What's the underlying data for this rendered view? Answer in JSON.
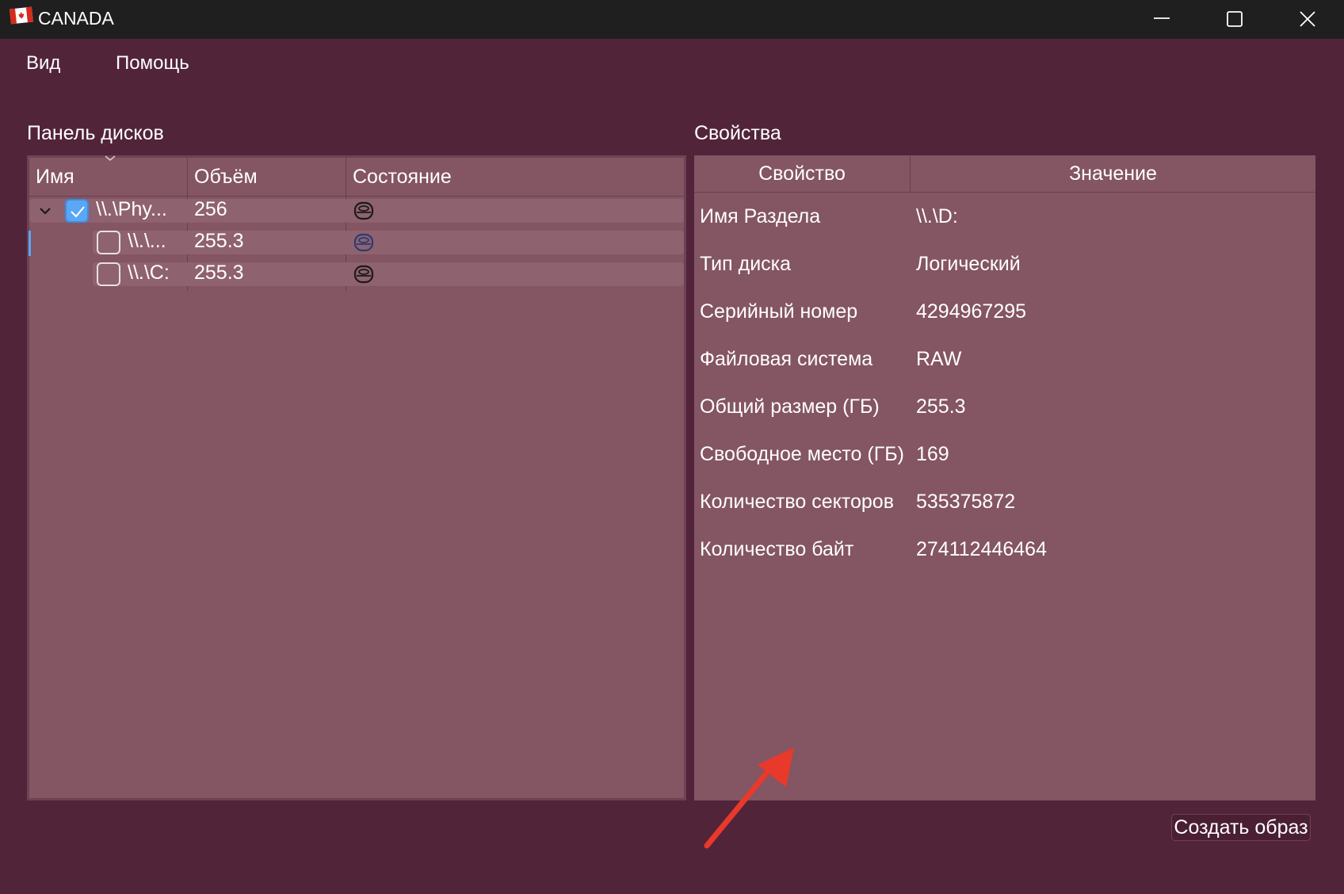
{
  "window": {
    "title": "CANADA",
    "icon": "canada-flag-icon",
    "controls": [
      "minimize-icon",
      "maximize-icon",
      "close-icon"
    ]
  },
  "menu": {
    "items": [
      {
        "label": "Вид"
      },
      {
        "label": "Помощь"
      }
    ]
  },
  "disks_panel": {
    "title": "Панель дисков",
    "columns": [
      "Имя",
      "Объём",
      "Состояние"
    ],
    "rows": [
      {
        "name": "\\\\.\\Phy...",
        "size": "256",
        "checked": true,
        "expanded": true,
        "status_icon": "disk-drive-icon"
      },
      {
        "name": "\\\\.\\...",
        "size": "255.3",
        "checked": false,
        "status_icon": "disk-drive-icon"
      },
      {
        "name": "\\\\.\\C:",
        "size": "255.3",
        "checked": false,
        "status_icon": "disk-drive-icon"
      }
    ]
  },
  "properties_panel": {
    "title": "Свойства",
    "columns": [
      "Свойство",
      "Значение"
    ],
    "rows": [
      {
        "name": "Имя Раздела",
        "value": "\\\\.\\D:"
      },
      {
        "name": "Тип диска",
        "value": "Логический"
      },
      {
        "name": "Серийный номер",
        "value": "4294967295"
      },
      {
        "name": "Файловая система",
        "value": "RAW"
      },
      {
        "name": "Общий размер (ГБ)",
        "value": "255.3"
      },
      {
        "name": "Свободное место (ГБ)",
        "value": "169"
      },
      {
        "name": "Количество секторов",
        "value": "535375872"
      },
      {
        "name": "Количество байт",
        "value": "274112446464"
      }
    ]
  },
  "actions": {
    "create_image_label": "Создать образ"
  },
  "colors": {
    "background": "#52243a",
    "panel": "#845562",
    "titlebar": "#1f1f1f",
    "checkbox_accent": "#5aa7f5",
    "annotation_arrow": "#e8392b"
  }
}
